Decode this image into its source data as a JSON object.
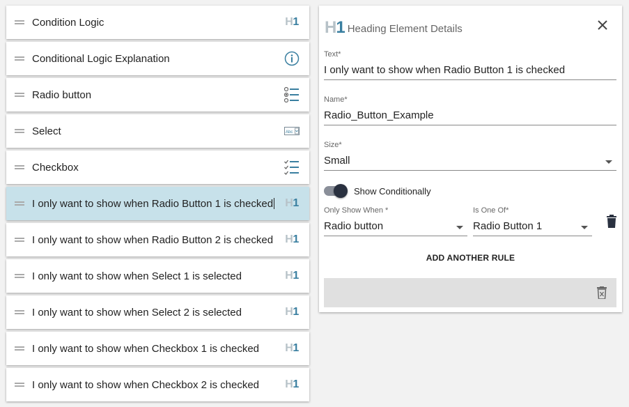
{
  "elements": [
    {
      "label": "Condition Logic",
      "icon": "heading-icon"
    },
    {
      "label": "Conditional Logic Explanation",
      "icon": "info-icon"
    },
    {
      "label": "Radio button",
      "icon": "radio-list-icon"
    },
    {
      "label": "Select",
      "icon": "select-icon"
    },
    {
      "label": "Checkbox",
      "icon": "checkbox-list-icon"
    },
    {
      "label": "I only want to show when Radio Button 1 is checked",
      "icon": "heading-icon",
      "selected": true
    },
    {
      "label": "I only want to show when Radio Button 2 is checked",
      "icon": "heading-icon"
    },
    {
      "label": "I only want to show when Select 1 is selected",
      "icon": "heading-icon"
    },
    {
      "label": "I only want to show when Select 2 is selected",
      "icon": "heading-icon"
    },
    {
      "label": "I only want to show when Checkbox 1 is checked",
      "icon": "heading-icon"
    },
    {
      "label": "I only want to show when Checkbox 2 is checked",
      "icon": "heading-icon"
    }
  ],
  "heading_icon": {
    "h": "H",
    "n": "1"
  },
  "select_icon_text": "Abc",
  "panel": {
    "title": "Heading Element Details",
    "text_label": "Text*",
    "text_value": "I only want to show when Radio Button 1 is checked",
    "name_label": "Name*",
    "name_value": "Radio_Button_Example",
    "size_label": "Size*",
    "size_value": "Small",
    "show_conditionally_label": "Show Conditionally",
    "show_conditionally_on": true,
    "rule": {
      "when_label": "Only Show When *",
      "when_value": "Radio button",
      "is_one_of_label": "Is One Of*",
      "is_one_of_value": "Radio Button 1"
    },
    "add_rule_label": "ADD ANOTHER RULE"
  },
  "colors": {
    "selected_row": "#c7e1ea",
    "heading_accent": "#3a7fa0",
    "toggle_thumb": "#2a3140"
  }
}
